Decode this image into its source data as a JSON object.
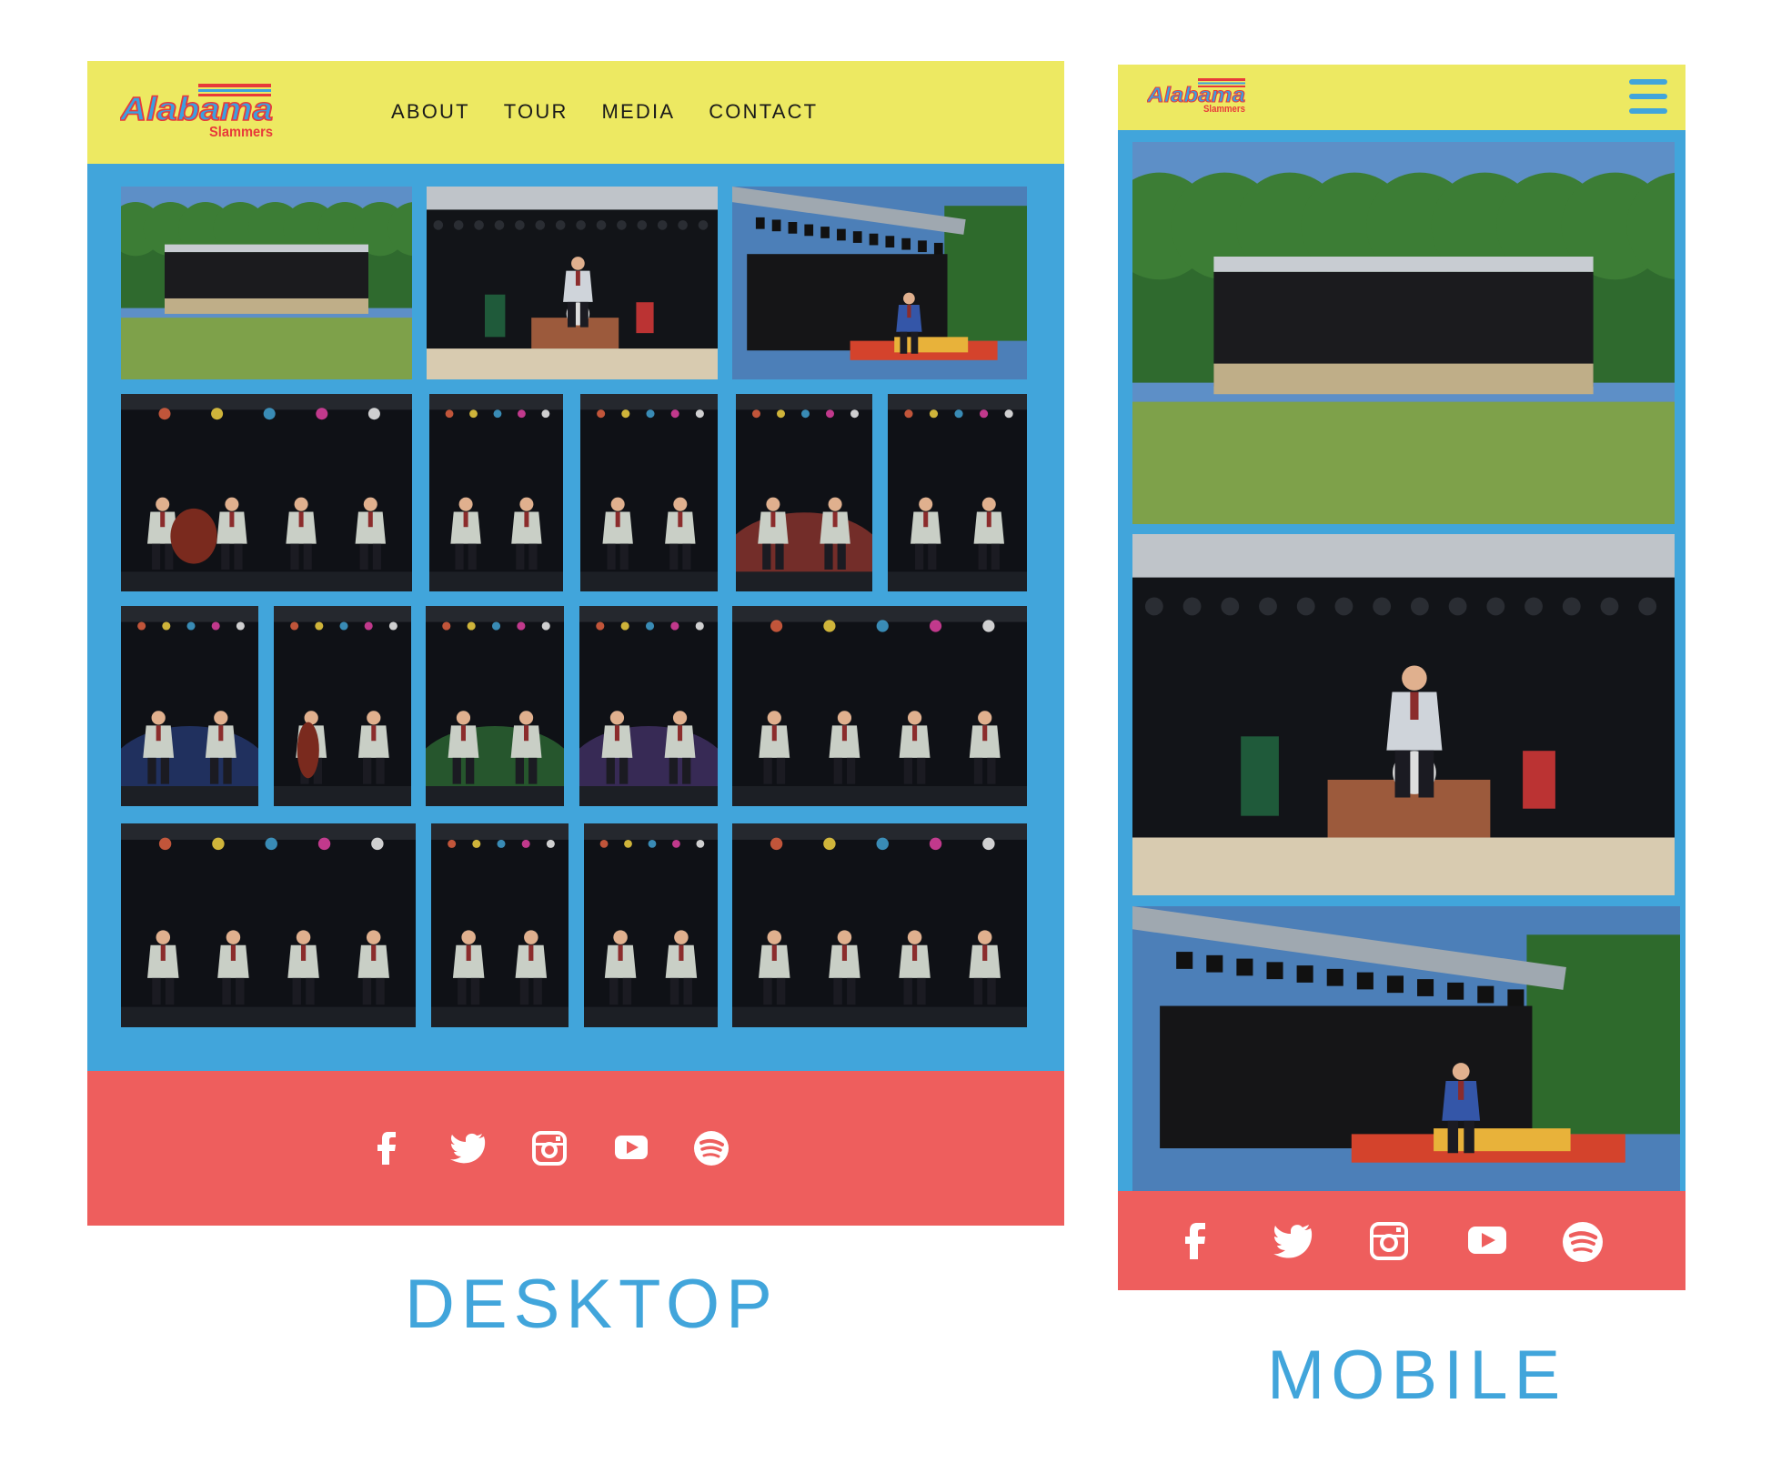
{
  "brand": {
    "name_line1": "Alabama",
    "name_line2": "Slammers"
  },
  "desktop": {
    "nav": [
      "ABOUT",
      "TOUR",
      "MEDIA",
      "CONTACT"
    ],
    "photos": [
      {
        "scene": "outdoor-stage"
      },
      {
        "scene": "stage-drums"
      },
      {
        "scene": "stage-lights"
      },
      {
        "scene": "band-bass"
      },
      {
        "scene": "sax-duo"
      },
      {
        "scene": "sax-trio"
      },
      {
        "scene": "guitar-red"
      },
      {
        "scene": "keyboard"
      },
      {
        "scene": "singer-blue"
      },
      {
        "scene": "bass-player"
      },
      {
        "scene": "singer-green"
      },
      {
        "scene": "drummer"
      },
      {
        "scene": "band-wide"
      },
      {
        "scene": "band-full"
      },
      {
        "scene": "sax-solo"
      },
      {
        "scene": "guitar-solo"
      },
      {
        "scene": "band-right"
      }
    ]
  },
  "mobile": {
    "menu_icon": "hamburger-menu-icon",
    "photos": [
      {
        "scene": "outdoor-stage"
      },
      {
        "scene": "stage-drums"
      },
      {
        "scene": "stage-lights"
      }
    ]
  },
  "social": [
    "facebook-icon",
    "twitter-icon",
    "instagram-icon",
    "youtube-icon",
    "spotify-icon"
  ],
  "captions": {
    "desktop": "DESKTOP",
    "mobile": "MOBILE"
  },
  "colors": {
    "header": "#ede962",
    "gallery": "#41a5db",
    "footer": "#ee5e5d",
    "caption": "#41a5db",
    "logo_blue": "#3ba0e0",
    "logo_red": "#e83a3a"
  }
}
